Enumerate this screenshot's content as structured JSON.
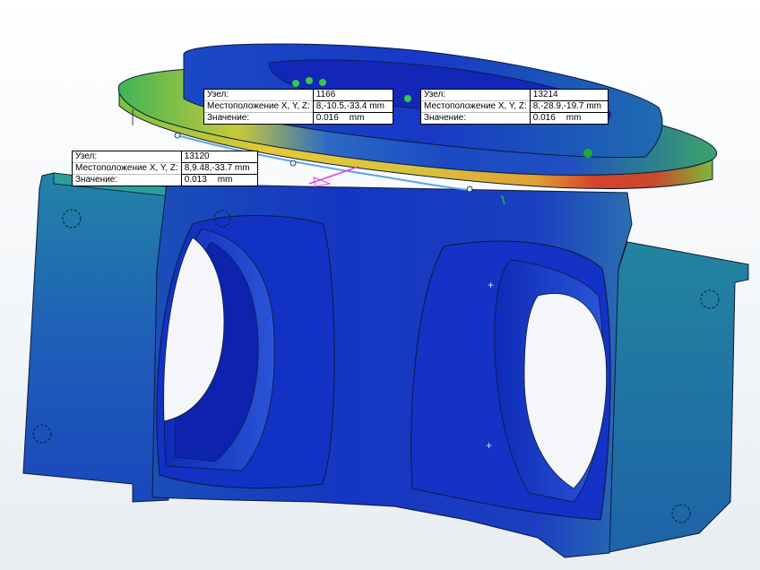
{
  "probes": [
    {
      "node_label": "Узел:",
      "node": "1166",
      "location_label": "Местоположение X, Y, Z:",
      "location": "8,-10.5,-33.4 mm",
      "value_label": "Значение:",
      "value": "0.016",
      "unit": "mm"
    },
    {
      "node_label": "Узел:",
      "node": "13214",
      "location_label": "Местоположение X, Y, Z:",
      "location": "8,-28.9,-19.7 mm",
      "value_label": "Значение:",
      "value": "0.016",
      "unit": "mm"
    },
    {
      "node_label": "Узел:",
      "node": "13120",
      "location_label": "Местоположение X, Y, Z:",
      "location": "8,9.48,-33.7 mm",
      "value_label": "Значение:",
      "value": "0.013",
      "unit": "mm"
    }
  ],
  "colors": {
    "background": "#f3f6f9",
    "low": "#1b33c9",
    "mid_low": "#1e8fb0",
    "mid": "#3dbb4f",
    "mid_high": "#e2c92b",
    "high": "#d73021",
    "probe_line": "#5ba6e8",
    "triad": "#e040e0"
  }
}
